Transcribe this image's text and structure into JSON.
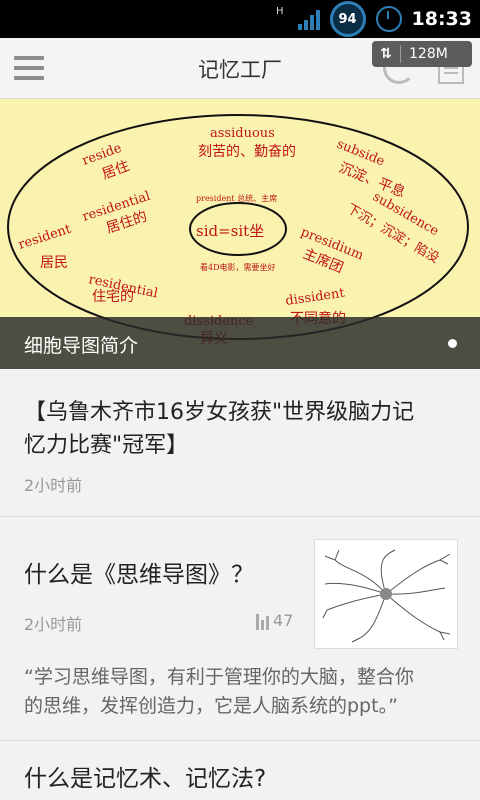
{
  "status_bar": {
    "network_type": "H",
    "battery_level": "94",
    "time": "18:33",
    "accent_color": "#2d7fb8"
  },
  "header": {
    "title": "记忆工厂",
    "memory_badge": "128M",
    "menu_icon": "menu-icon",
    "refresh_icon": "refresh-icon",
    "doc_icon": "document-icon"
  },
  "banner": {
    "caption": "细胞导图简介",
    "mind_map": {
      "center": "sid=sit坐",
      "center_notes_top": "president 总统、主席",
      "center_notes_bottom": "看4D电影，需要坐好",
      "nodes": [
        {
          "en": "assiduous",
          "zh": "刻苦的、勤奋的"
        },
        {
          "en": "reside",
          "zh": "居住"
        },
        {
          "en": "residential",
          "zh": "居住的"
        },
        {
          "en": "resident",
          "zh": "居民"
        },
        {
          "en": "residential",
          "zh": "住宅的"
        },
        {
          "en": "subside",
          "zh": "沉淀、平息"
        },
        {
          "en": "subsidence",
          "zh": "下沉；沉淀；陷没"
        },
        {
          "en": "presidium",
          "zh": "主席团"
        },
        {
          "en": "dissident",
          "zh": "不同意的"
        },
        {
          "en": "dissidence",
          "zh": "异义"
        }
      ]
    }
  },
  "articles": [
    {
      "title_line1": "【乌鲁木齐市16岁女孩获\"世界级脑力记",
      "title_line2": "忆力比赛\"冠军】",
      "time": "2小时前"
    },
    {
      "title": "什么是《思维导图》？",
      "time": "2小时前",
      "views": "47",
      "desc_line1": "“学习思维导图，有利于管理你的大脑，整合你",
      "desc_line2": "的思维，发挥创造力，它是人脑系统的ppt。”"
    },
    {
      "title": "什么是记忆术、记忆法?"
    }
  ]
}
